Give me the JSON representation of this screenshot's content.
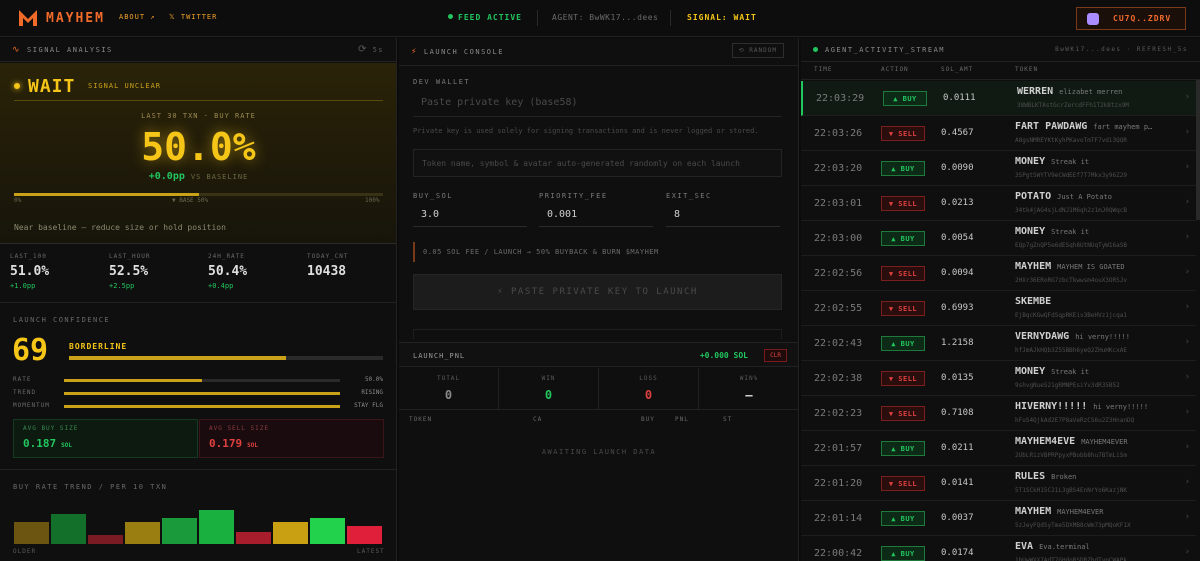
{
  "topbar": {
    "brand": "MAYHEM",
    "about": "ABOUT ↗",
    "twitter": "𝕏 TWITTER",
    "feed": "FEED ACTIVE",
    "agent": "AGENT: BwWK17...dees",
    "signal": "SIGNAL: WAIT",
    "wallet": "CU7Q..ZDRV",
    "colors": {
      "accent": "#f06a2a",
      "yellow": "#f5c518",
      "green": "#22c55e",
      "red": "#e04040"
    }
  },
  "signal_panel": {
    "title": "SIGNAL ANALYSIS",
    "refresh": "5s",
    "state": "WAIT",
    "state_sub": "SIGNAL UNCLEAR",
    "rate_label": "LAST 30 TXN · BUY RATE",
    "rate": "50.0%",
    "rate_delta": "+0.0pp",
    "rate_delta_suffix": "VS BASELINE",
    "rate_fraction": 0.5,
    "tick_left": "0%",
    "tick_mid": "▼ BASE 50%",
    "tick_right": "100%",
    "advice": "Near baseline — reduce size or hold position",
    "stats": [
      {
        "label": "LAST_100",
        "value": "51.0%",
        "delta": "+1.0pp"
      },
      {
        "label": "LAST_HOUR",
        "value": "52.5%",
        "delta": "+2.5pp"
      },
      {
        "label": "24H_RATE",
        "value": "50.4%",
        "delta": "+0.4pp"
      },
      {
        "label": "TODAY_CNT",
        "value": "10438",
        "delta": ""
      }
    ],
    "confidence": {
      "title": "LAUNCH CONFIDENCE",
      "score": "69",
      "label": "BORDERLINE",
      "fraction": 0.69,
      "factors": [
        {
          "name": "RATE",
          "value": "50.0%",
          "fraction": 0.5
        },
        {
          "name": "TREND",
          "value": "RISING",
          "fraction": 1.0
        },
        {
          "name": "MOMENTUM",
          "value": "STAY FLG",
          "fraction": 1.0
        }
      ]
    },
    "avg_buy": {
      "label": "AVG BUY SIZE",
      "value": "0.187",
      "unit": "SOL"
    },
    "avg_sell": {
      "label": "AVG SELL SIZE",
      "value": "0.179",
      "unit": "SOL"
    },
    "trend": {
      "title": "BUY RATE TREND / PER 10 TXN",
      "left": "OLDER",
      "right": "LATEST",
      "bars": [
        {
          "h": 0.55,
          "c": "#6b5510"
        },
        {
          "h": 0.75,
          "c": "#13702b"
        },
        {
          "h": 0.22,
          "c": "#7a1a22"
        },
        {
          "h": 0.55,
          "c": "#9a7e12"
        },
        {
          "h": 0.65,
          "c": "#1a9a3a"
        },
        {
          "h": 0.85,
          "c": "#1ab03f"
        },
        {
          "h": 0.3,
          "c": "#a81d2c"
        },
        {
          "h": 0.55,
          "c": "#c9a012"
        },
        {
          "h": 0.65,
          "c": "#22d24c"
        },
        {
          "h": 0.45,
          "c": "#e0203a"
        }
      ]
    }
  },
  "console": {
    "title": "LAUNCH CONSOLE",
    "random": "⟲ RANDOM",
    "dev_wallet": "DEV WALLET",
    "pk_placeholder": "Paste private key (base58)",
    "pk_hint": "Private key is used solely for signing transactions and is never logged or stored.",
    "token_placeholder": "Token name, symbol & avatar auto-generated randomly on each launch",
    "buy_sol_label": "BUY_SOL",
    "buy_sol": "3.0",
    "priority_label": "PRIORITY_FEE",
    "priority": "0.001",
    "exit_label": "EXIT_SEC",
    "exit": "8",
    "fee": "0.05 SOL FEE / LAUNCH → 50% BUYBACK & BURN $MAYHEM",
    "launch": "⚡ PASTE PRIVATE KEY TO LAUNCH"
  },
  "pnl": {
    "title": "LAUNCH_PNL",
    "total_value": "+0.000 SOL",
    "clr": "CLR",
    "cells": [
      {
        "label": "TOTAL",
        "value": "0",
        "color": "#8a8a8a"
      },
      {
        "label": "WIN",
        "value": "0",
        "color": "#22c55e"
      },
      {
        "label": "LOSS",
        "value": "0",
        "color": "#e04040"
      },
      {
        "label": "WIN%",
        "value": "—",
        "color": "#d0d0d0"
      }
    ],
    "headers": [
      "TOKEN",
      "CA",
      "BUY",
      "PNL",
      "ST"
    ],
    "empty": "AWAITING LAUNCH DATA"
  },
  "activity": {
    "title": "AGENT_ACTIVITY_STREAM",
    "right": "BwWK17...dees · REFRESH_5s",
    "headers": [
      "TIME",
      "ACTION",
      "SOL_AMT",
      "TOKEN"
    ],
    "rows": [
      {
        "time": "22:03:29",
        "action": "▲ BUY",
        "type": "buy",
        "sol": "0.0111",
        "name": "WERREN",
        "desc": "elizabet merren",
        "ca": "38WBLKTAstGcrZercdFFh1T2k8tzx9M"
      },
      {
        "time": "22:03:26",
        "action": "▼ SELL",
        "type": "sell",
        "sol": "0.4567",
        "name": "FART PAWDAWG",
        "desc": "fart mayhem p…",
        "ca": "A8gsNMREYKtKyhPKavoTmTF7vdi3QQR"
      },
      {
        "time": "22:03:20",
        "action": "▲ BUY",
        "type": "buy",
        "sol": "0.0090",
        "name": "MONEY",
        "desc": "Streak it",
        "ca": "3SPgt5WYTV9eCWdEEf7T7Mkx3y96Z29"
      },
      {
        "time": "22:03:01",
        "action": "▼ SELL",
        "type": "sell",
        "sol": "0.0213",
        "name": "POTATO",
        "desc": "Just A Potato",
        "ca": "34tk4jAG4sjLdNJ1M6qh2z1mJ0QWqcB"
      },
      {
        "time": "22:03:00",
        "action": "▲ BUY",
        "type": "buy",
        "sol": "0.0054",
        "name": "MONEY",
        "desc": "Streak it",
        "ca": "EQp7gZnQP5e6dESqh8UtNUqTyW16aSB"
      },
      {
        "time": "22:02:56",
        "action": "▼ SELL",
        "type": "sell",
        "sol": "0.0094",
        "name": "MAYHEM",
        "desc": "MAYHEM IS GOATED",
        "ca": "2HXr36ERoRG7zbcTkwwsm4ouX3ORSJv"
      },
      {
        "time": "22:02:55",
        "action": "▼ SELL",
        "type": "sell",
        "sol": "0.6993",
        "name": "SKEMBE",
        "desc": "",
        "ca": "EjBqcKGwQFdSqpRKEiv3BeHVz1jcqa1"
      },
      {
        "time": "22:02:43",
        "action": "▲ BUY",
        "type": "buy",
        "sol": "1.2158",
        "name": "VERNYDAWG",
        "desc": "hi verny!!!!!",
        "ca": "hfJmAJkHQb3Z55BBh6yeQ2ZHuHKcxAE"
      },
      {
        "time": "22:02:38",
        "action": "▼ SELL",
        "type": "sell",
        "sol": "0.0135",
        "name": "MONEY",
        "desc": "Streak it",
        "ca": "9shvgNueS21gRMNPEsiYv3dR35B52"
      },
      {
        "time": "22:02:23",
        "action": "▼ SELL",
        "type": "sell",
        "sol": "0.7108",
        "name": "HIVERNY!!!!!",
        "desc": "hi verny!!!!!",
        "ca": "hFuS4QjkAd2E7P8aVeRzCS6u2Z3HnanDQ"
      },
      {
        "time": "22:01:57",
        "action": "▲ BUY",
        "type": "buy",
        "sol": "0.0211",
        "name": "MAYHEM4EVE",
        "desc": "MAYHEM4EVER",
        "ca": "2UbLR1zVBPRPpyxPBobb8hu7BTmLiSm"
      },
      {
        "time": "22:01:20",
        "action": "▼ SELL",
        "type": "sell",
        "sol": "0.0141",
        "name": "RULES",
        "desc": "Broken",
        "ca": "5T1SCkH15C21L3gBS4EnNrYo6KazjNK"
      },
      {
        "time": "22:01:14",
        "action": "▲ BUY",
        "type": "buy",
        "sol": "0.0037",
        "name": "MAYHEM",
        "desc": "MAYHEM4EVER",
        "ca": "5zJeyFQdSyTme5DXMB8cWm73pMQoKF1X"
      },
      {
        "time": "22:00:42",
        "action": "▲ BUY",
        "type": "buy",
        "sol": "0.0174",
        "name": "EVA",
        "desc": "Eva.terminal",
        "ca": "1bUwWXX7AdT7GHdoRSDRZhdTypCWAPk"
      }
    ]
  }
}
